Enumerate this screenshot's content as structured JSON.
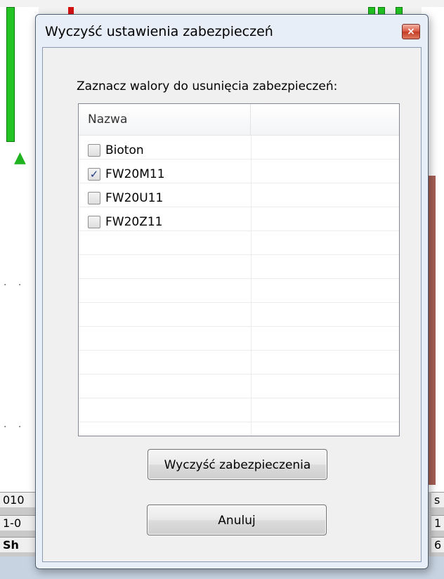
{
  "background": {
    "cells": [
      "010",
      "1-0",
      "Sh",
      "s",
      "1",
      "6"
    ]
  },
  "dialog": {
    "title": "Wyczyść ustawienia zabezpieczeń",
    "close_glyph": "×",
    "prompt": "Zaznacz walory do usunięcia zabezpieczeń:",
    "list": {
      "columns": [
        "Nazwa",
        ""
      ],
      "items": [
        {
          "label": "Bioton",
          "checked": false
        },
        {
          "label": "FW20M11",
          "checked": true
        },
        {
          "label": "FW20U11",
          "checked": false
        },
        {
          "label": "FW20Z11",
          "checked": false
        }
      ]
    },
    "buttons": {
      "clear": "Wyczyść zabezpieczenia",
      "cancel": "Anuluj"
    }
  },
  "colors": {
    "accent_green": "#22c322",
    "accent_red": "#d41111",
    "close_red": "#c23a23"
  }
}
